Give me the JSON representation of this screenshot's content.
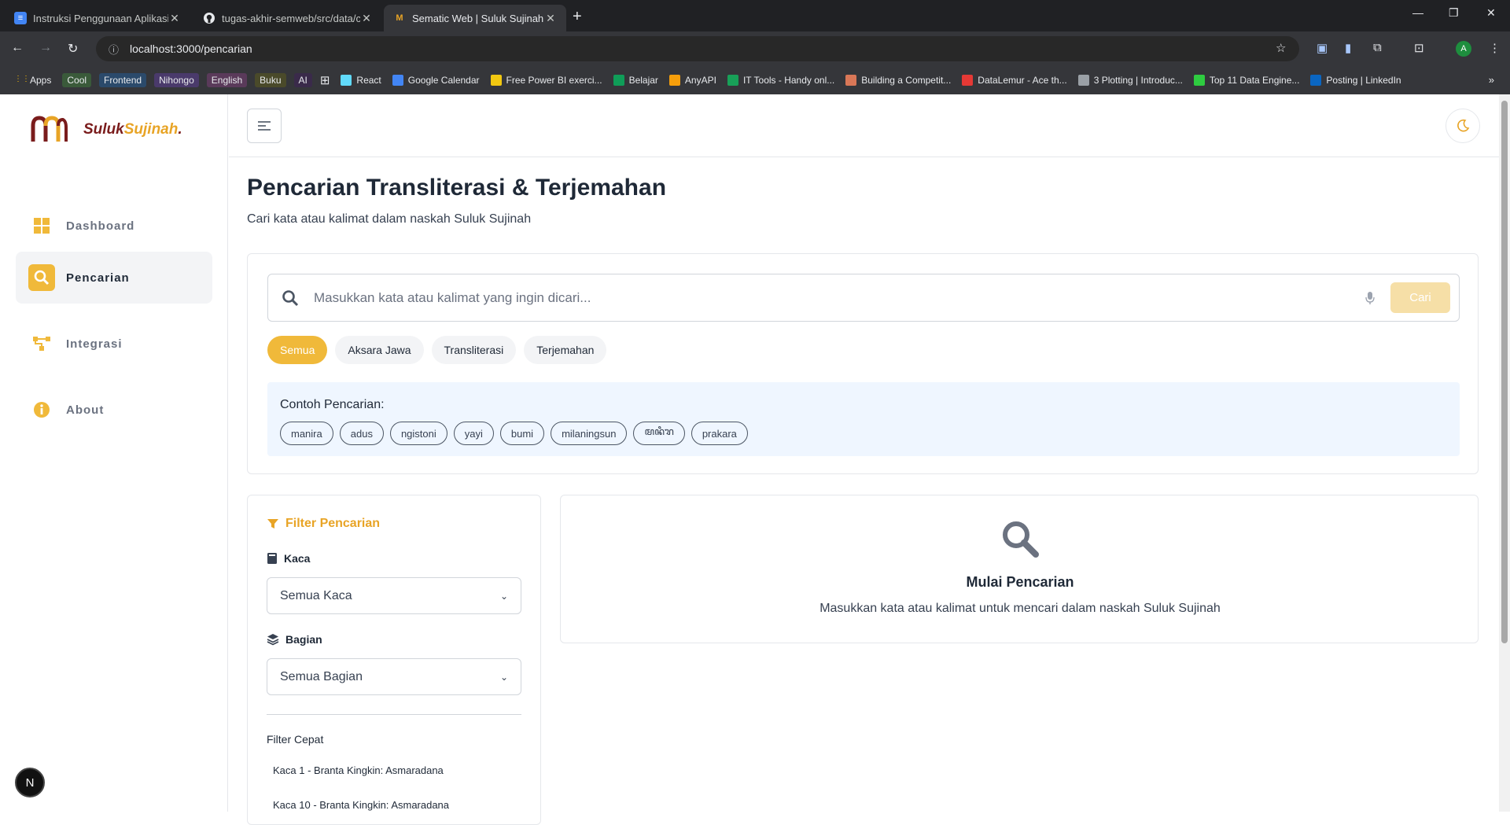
{
  "browser": {
    "tabs": [
      {
        "title": "Instruksi Penggunaan Aplikasi -",
        "favicon": "docs-icon",
        "active": false
      },
      {
        "title": "tugas-akhir-semweb/src/data/c",
        "favicon": "github-icon",
        "active": false
      },
      {
        "title": "Sematic Web | Suluk Sujinah",
        "favicon": "suluk-icon",
        "active": true
      }
    ],
    "new_tab_symbol": "+",
    "url": "localhost:3000/pencarian",
    "avatar_letter": "A",
    "bookmarks": [
      {
        "label": "Apps",
        "type": "apps"
      },
      {
        "label": "Cool",
        "type": "folder",
        "color": "#3a5a3a"
      },
      {
        "label": "Frontend",
        "type": "folder",
        "color": "#2b4a6b"
      },
      {
        "label": "Nihongo",
        "type": "folder",
        "color": "#4a3a6b"
      },
      {
        "label": "English",
        "type": "folder",
        "color": "#5a3a5a"
      },
      {
        "label": "Buku",
        "type": "folder",
        "color": "#4a4a2a"
      },
      {
        "label": "AI",
        "type": "folder",
        "color": "#3a2a4a"
      },
      {
        "label": "",
        "type": "grid"
      },
      {
        "label": "React",
        "type": "link",
        "color": "#61dafb"
      },
      {
        "label": "Google Calendar",
        "type": "link",
        "color": "#4285f4"
      },
      {
        "label": "Free Power BI exerci...",
        "type": "link",
        "color": "#f2c811"
      },
      {
        "label": "Belajar",
        "type": "link",
        "color": "#0f9d58"
      },
      {
        "label": "AnyAPI",
        "type": "link",
        "color": "#f59e0b"
      },
      {
        "label": "IT Tools - Handy onl...",
        "type": "link",
        "color": "#18a058"
      },
      {
        "label": "Building a Competit...",
        "type": "link",
        "color": "#d97757"
      },
      {
        "label": "DataLemur - Ace th...",
        "type": "link",
        "color": "#e53935"
      },
      {
        "label": "3 Plotting | Introduc...",
        "type": "link",
        "color": "#9aa0a6"
      },
      {
        "label": "Top 11 Data Engine...",
        "type": "link",
        "color": "#2ecc40"
      },
      {
        "label": "Posting | LinkedIn",
        "type": "link",
        "color": "#0a66c2"
      }
    ],
    "bookmarks_more": "»"
  },
  "sidebar": {
    "brand_part1": "Suluk",
    "brand_part2": "Sujinah",
    "brand_dot": ".",
    "items": [
      {
        "label": "Dashboard",
        "icon": "grid-icon",
        "active": false
      },
      {
        "label": "Pencarian",
        "icon": "search-icon",
        "active": true
      },
      {
        "label": "Integrasi",
        "icon": "flow-icon",
        "active": false
      },
      {
        "label": "About",
        "icon": "info-icon",
        "active": false
      }
    ],
    "badge_letter": "N"
  },
  "page": {
    "title": "Pencarian Transliterasi & Terjemahan",
    "subtitle": "Cari kata atau kalimat dalam naskah Suluk Sujinah"
  },
  "search": {
    "placeholder": "Masukkan kata atau kalimat yang ingin dicari...",
    "button": "Cari",
    "chips": [
      "Semua",
      "Aksara Jawa",
      "Transliterasi",
      "Terjemahan"
    ],
    "active_chip": "Semua",
    "examples_label": "Contoh Pencarian:",
    "examples": [
      "manira",
      "adus",
      "ngistoni",
      "yayi",
      "bumi",
      "milaningsun",
      "ꦩꦤꦶꦫ",
      "prakara"
    ]
  },
  "filters": {
    "title": "Filter Pencarian",
    "kaca_label": "Kaca",
    "kaca_value": "Semua Kaca",
    "bagian_label": "Bagian",
    "bagian_value": "Semua Bagian",
    "quick_label": "Filter Cepat",
    "quick": [
      "Kaca 1 - Branta Kingkin: Asmaradana",
      "Kaca 10 - Branta Kingkin: Asmaradana"
    ]
  },
  "results": {
    "title": "Mulai Pencarian",
    "subtitle": "Masukkan kata atau kalimat untuk mencari dalam naskah Suluk Sujinah"
  },
  "colors": {
    "accent": "#f0b93a",
    "brand_dark": "#7a1c1c",
    "examples_bg": "#eff6ff"
  }
}
